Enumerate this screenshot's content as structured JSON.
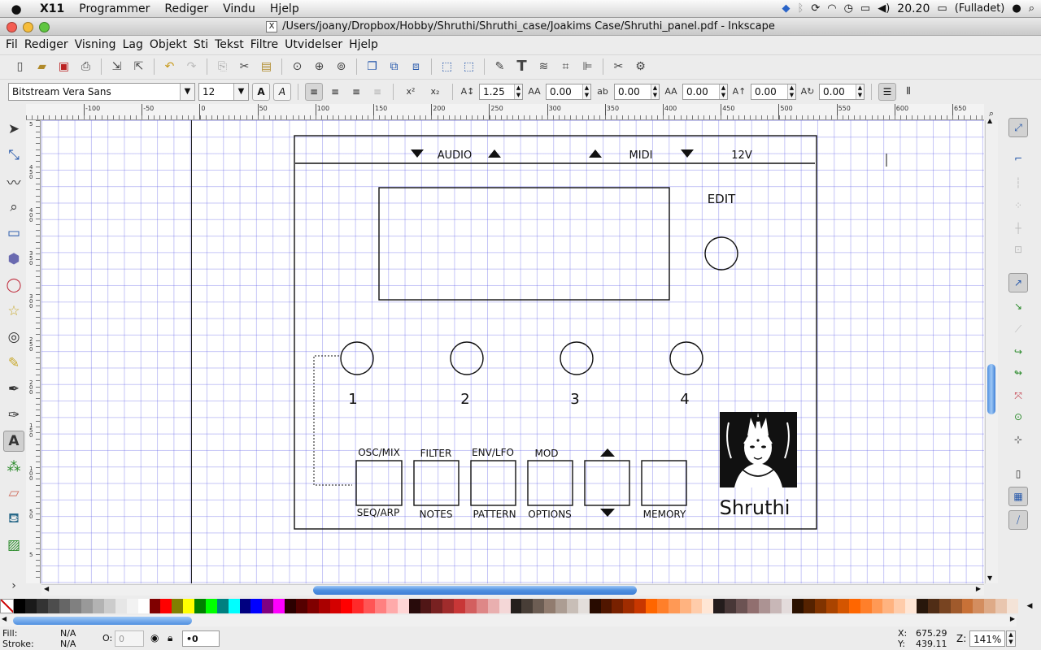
{
  "menubar": {
    "apple": "",
    "items": [
      "X11",
      "Programmer",
      "Rediger",
      "Vindu",
      "Hjelp"
    ],
    "clock": "20.20",
    "battery": "(Fulladet)"
  },
  "window": {
    "title": "/Users/joany/Dropbox/Hobby/Shruthi/Shruthi_case/Joakims Case/Shruthi_panel.pdf - Inkscape",
    "x11_badge": "X"
  },
  "app_menu": [
    "Fil",
    "Rediger",
    "Visning",
    "Lag",
    "Objekt",
    "Sti",
    "Tekst",
    "Filtre",
    "Utvidelser",
    "Hjelp"
  ],
  "text_toolbar": {
    "font_family": "Bitstream Vera Sans",
    "font_size": "12",
    "bold": "A",
    "italic": "A",
    "superscript": "x²",
    "subscript": "x₂",
    "line_spacing": "1.25",
    "letter_spacing": "0.00",
    "word_spacing": "0.00",
    "dx": "0.00",
    "dy": "0.00",
    "rotation": "0.00"
  },
  "rulers": {
    "h_labels": [
      "-100",
      "-50",
      "0",
      "50",
      "100",
      "150",
      "200",
      "250",
      "300",
      "350",
      "400",
      "450",
      "500",
      "550",
      "600",
      "650"
    ],
    "v_labels": [
      "5",
      "4 5 0",
      "4 0 0",
      "3 5 0",
      "3 0 0",
      "2 5 0",
      "2 0 0",
      "1 5 0",
      "1 0 0",
      "5 0",
      "5"
    ]
  },
  "panel": {
    "header_labels": [
      "AUDIO",
      "MIDI",
      "12V"
    ],
    "edit_label": "EDIT",
    "knob_numbers": [
      "1",
      "2",
      "3",
      "4"
    ],
    "buttons_top": [
      "OSC/MIX",
      "FILTER",
      "ENV/LFO",
      "MOD"
    ],
    "buttons_bottom": [
      "SEQ/ARP",
      "NOTES",
      "PATTERN",
      "OPTIONS",
      "MEMORY"
    ],
    "logo_text": "Shruthi"
  },
  "status": {
    "fill_label": "Fill:",
    "fill_value": "N/A",
    "stroke_label": "Stroke:",
    "stroke_value": "N/A",
    "opacity_label": "O:",
    "opacity_value": "0",
    "layer_value": "•0",
    "x_label": "X:",
    "x_value": "675.29",
    "y_label": "Y:",
    "y_value": "439.11",
    "zoom_label": "Z:",
    "zoom_value": "141%"
  },
  "colors": {
    "grid": "#5a5ae6",
    "thumb": "#4f8fe0",
    "palette": [
      "#000000",
      "#1a1a1a",
      "#333333",
      "#4d4d4d",
      "#666666",
      "#808080",
      "#999999",
      "#b3b3b3",
      "#cccccc",
      "#e6e6e6",
      "#f2f2f2",
      "#ffffff",
      "#800000",
      "#ff0000",
      "#808000",
      "#ffff00",
      "#008000",
      "#00ff00",
      "#008080",
      "#00ffff",
      "#000080",
      "#0000ff",
      "#800080",
      "#ff00ff",
      "#2b0000",
      "#550000",
      "#800000",
      "#aa0000",
      "#d40000",
      "#ff0000",
      "#ff2a2a",
      "#ff5555",
      "#ff8080",
      "#ffaaaa",
      "#ffd5d5",
      "#280b0b",
      "#501616",
      "#782121",
      "#a02c2c",
      "#c83737",
      "#d35f5f",
      "#de8787",
      "#e9afaf",
      "#f4d7d7",
      "#241f1c",
      "#483e37",
      "#6c5d53",
      "#917c6f",
      "#ac9d93",
      "#c8beb7",
      "#e3dedb",
      "#280b00",
      "#501600",
      "#782100",
      "#a02c00",
      "#c83700",
      "#ff6600",
      "#ff7f2a",
      "#ff9955",
      "#ffb380",
      "#ffccaa",
      "#ffe6d5",
      "#241c1c",
      "#483737",
      "#6c5353",
      "#916f6f",
      "#ac9393",
      "#c8b7b7",
      "#e3dbdb",
      "#2b1100",
      "#552200",
      "#803300",
      "#aa4400",
      "#d45500",
      "#ff6600",
      "#ff7f2a",
      "#ff9955",
      "#ffb380",
      "#ffccaa",
      "#ffe6d5",
      "#28170b",
      "#502d16",
      "#784421",
      "#a05a2c",
      "#c87137",
      "#d38d5f",
      "#deaa87",
      "#e9c6af",
      "#f4e3d7"
    ]
  }
}
